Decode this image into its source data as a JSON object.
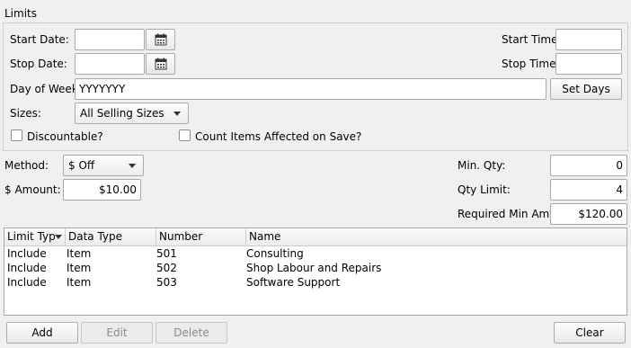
{
  "limits": {
    "section_title": "Limits",
    "start_date_label": "Start Date:",
    "start_date_value": "",
    "stop_date_label": "Stop Date:",
    "stop_date_value": "",
    "start_time_label": "Start Time:",
    "start_time_value": "",
    "stop_time_label": "Stop Time:",
    "stop_time_value": "",
    "day_of_week_label": "Day of Week:",
    "day_of_week_value": "YYYYYYY",
    "set_days_label": "Set Days",
    "sizes_label": "Sizes:",
    "sizes_value": "All Selling Sizes",
    "discountable_label": "Discountable?",
    "discountable_checked": false,
    "count_items_label": "Count Items Affected on Save?",
    "count_items_checked": false
  },
  "discount": {
    "method_label": "Method:",
    "method_value": "$ Off",
    "amount_label": "$ Amount:",
    "amount_value": "$10.00",
    "min_qty_label": "Min. Qty:",
    "min_qty_value": "0",
    "qty_limit_label": "Qty Limit:",
    "qty_limit_value": "4",
    "required_min_amt_label": "Required Min Amt:",
    "required_min_amt_value": "$120.00"
  },
  "table": {
    "columns": [
      "Limit Typ",
      "Data Type",
      "Number",
      "Name"
    ],
    "rows": [
      [
        "Include",
        "Item",
        "501",
        "Consulting"
      ],
      [
        "Include",
        "Item",
        "502",
        "Shop Labour and Repairs"
      ],
      [
        "Include",
        "Item",
        "503",
        "Software Support"
      ]
    ]
  },
  "actions": {
    "add_label": "Add",
    "edit_label": "Edit",
    "delete_label": "Delete",
    "clear_label": "Clear"
  },
  "icons": {
    "calendar": "calendar-icon",
    "sort": "sort-down-icon",
    "dropdown": "chevron-down-icon"
  }
}
